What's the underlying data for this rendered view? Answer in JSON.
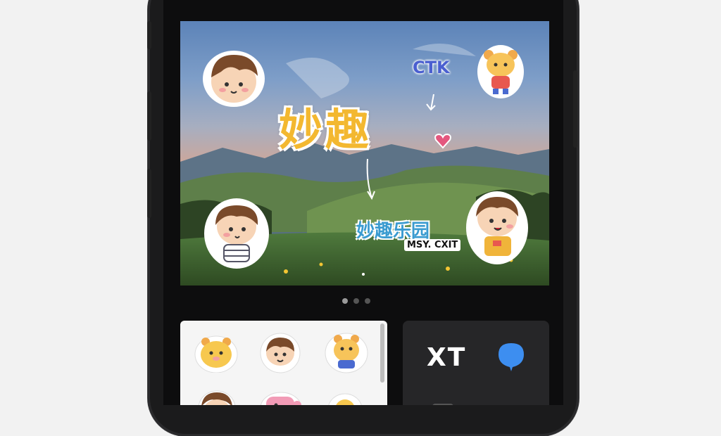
{
  "canvas": {
    "main_title": "妙趣",
    "top_label": "CTK",
    "caption_main": "妙趣乐园",
    "caption_small": "MSY. CXIT"
  },
  "pager": {
    "count": 3,
    "active_index": 0
  },
  "sticker_panel": {
    "items": [
      "bear-sticker",
      "boy-sticker",
      "bear-sticker",
      "boy-sticker",
      "pink-sticker",
      "bear-sticker"
    ]
  },
  "text_panel": {
    "label": "XT",
    "pin_color": "#3d8ef0"
  }
}
